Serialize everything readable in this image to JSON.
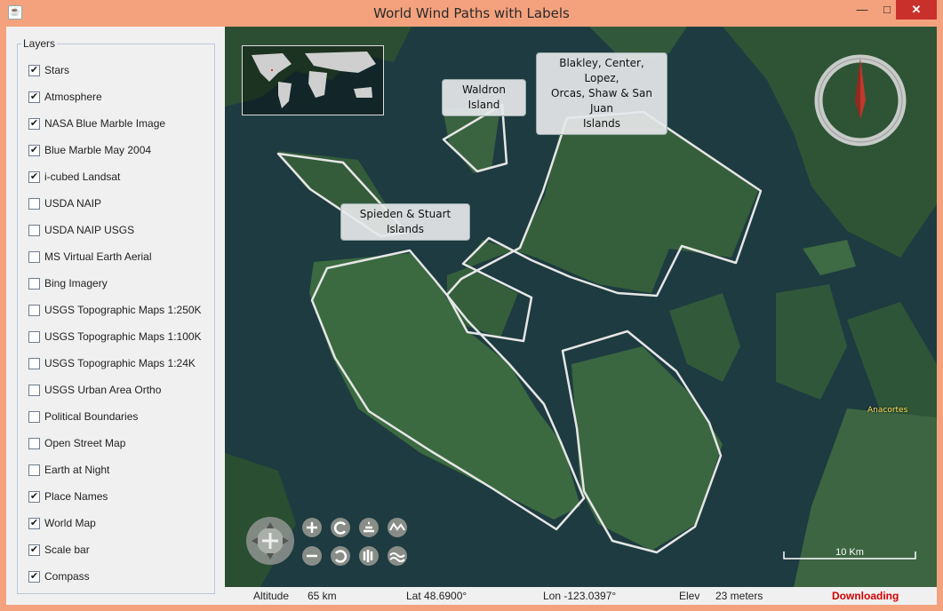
{
  "window": {
    "title": "World Wind Paths with Labels",
    "controls": {
      "minimize": "—",
      "maximize": "□",
      "close": "✕"
    }
  },
  "layers_panel": {
    "title": "Layers",
    "items": [
      {
        "label": "Stars",
        "checked": true
      },
      {
        "label": "Atmosphere",
        "checked": true
      },
      {
        "label": "NASA Blue Marble Image",
        "checked": true
      },
      {
        "label": "Blue Marble May 2004",
        "checked": true
      },
      {
        "label": "i-cubed Landsat",
        "checked": true
      },
      {
        "label": "USDA NAIP",
        "checked": false
      },
      {
        "label": "USDA NAIP USGS",
        "checked": false
      },
      {
        "label": "MS Virtual Earth Aerial",
        "checked": false
      },
      {
        "label": "Bing Imagery",
        "checked": false
      },
      {
        "label": "USGS Topographic Maps 1:250K",
        "checked": false
      },
      {
        "label": "USGS Topographic Maps 1:100K",
        "checked": false
      },
      {
        "label": "USGS Topographic Maps 1:24K",
        "checked": false
      },
      {
        "label": "USGS Urban Area Ortho",
        "checked": false
      },
      {
        "label": "Political Boundaries",
        "checked": false
      },
      {
        "label": "Open Street Map",
        "checked": false
      },
      {
        "label": "Earth at Night",
        "checked": false
      },
      {
        "label": "Place Names",
        "checked": true
      },
      {
        "label": "World Map",
        "checked": true
      },
      {
        "label": "Scale bar",
        "checked": true
      },
      {
        "label": "Compass",
        "checked": true
      }
    ]
  },
  "map": {
    "labels": {
      "waldron": "Waldron Island",
      "blakley": [
        "Blakley, Center, Lopez,",
        "Orcas, Shaw & San Juan",
        "Islands"
      ],
      "spieden": "Spieden & Stuart Islands",
      "anacortes": "Anacortes"
    },
    "scale_label": "10 Km",
    "colors": {
      "path": "#e8e8e8",
      "land": "#2f5a35",
      "water": "#1c3a3f",
      "accent": "#c0392b"
    },
    "nav_controls": [
      "pan-icon",
      "zoom-in-icon",
      "zoom-out-icon",
      "rotate-left-icon",
      "rotate-right-icon",
      "tilt-up-icon",
      "tilt-down-icon",
      "vertical-exaggeration-up-icon",
      "vertical-exaggeration-down-icon"
    ]
  },
  "status": {
    "altitude_label": "Altitude",
    "altitude_value": "65 km",
    "lat": "Lat 48.6900°",
    "lon": "Lon -123.0397°",
    "elev_label": "Elev",
    "elev_value": "23 meters",
    "state": "Downloading"
  }
}
